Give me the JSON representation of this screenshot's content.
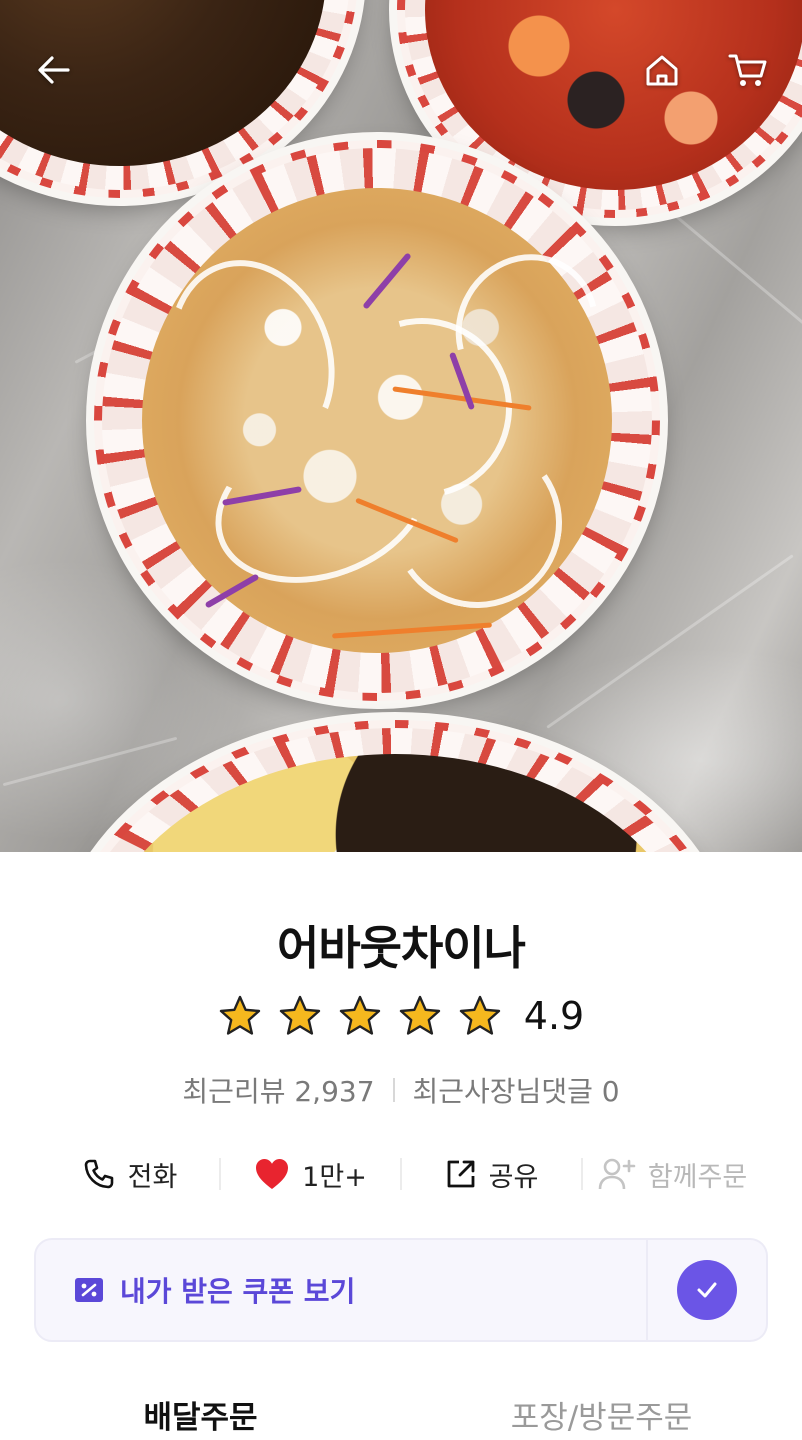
{
  "header": {
    "back_icon": "arrow-left-icon",
    "home_icon": "home-icon",
    "cart_icon": "cart-icon"
  },
  "store": {
    "name": "어바웃차이나",
    "rating": "4.9",
    "stars": 5,
    "recent_reviews_label": "최근리뷰 2,937",
    "owner_replies_label": "최근사장님댓글 0"
  },
  "actions": [
    {
      "icon": "phone-icon",
      "label": "전화"
    },
    {
      "icon": "heart-icon",
      "label": "1만+"
    },
    {
      "icon": "share-icon",
      "label": "공유"
    },
    {
      "icon": "add-person-icon",
      "label": "함께주문"
    }
  ],
  "coupon": {
    "icon": "coupon-icon",
    "label": "내가 받은 쿠폰 보기",
    "check_icon": "check-icon"
  },
  "tabs": [
    {
      "label": "배달주문",
      "active": true
    },
    {
      "label": "포장/방문주문",
      "active": false
    }
  ],
  "colors": {
    "accent": "#6b55e6",
    "coupon_text": "#5b48d8",
    "heart": "#e8242f",
    "star": "#f5b81e"
  }
}
